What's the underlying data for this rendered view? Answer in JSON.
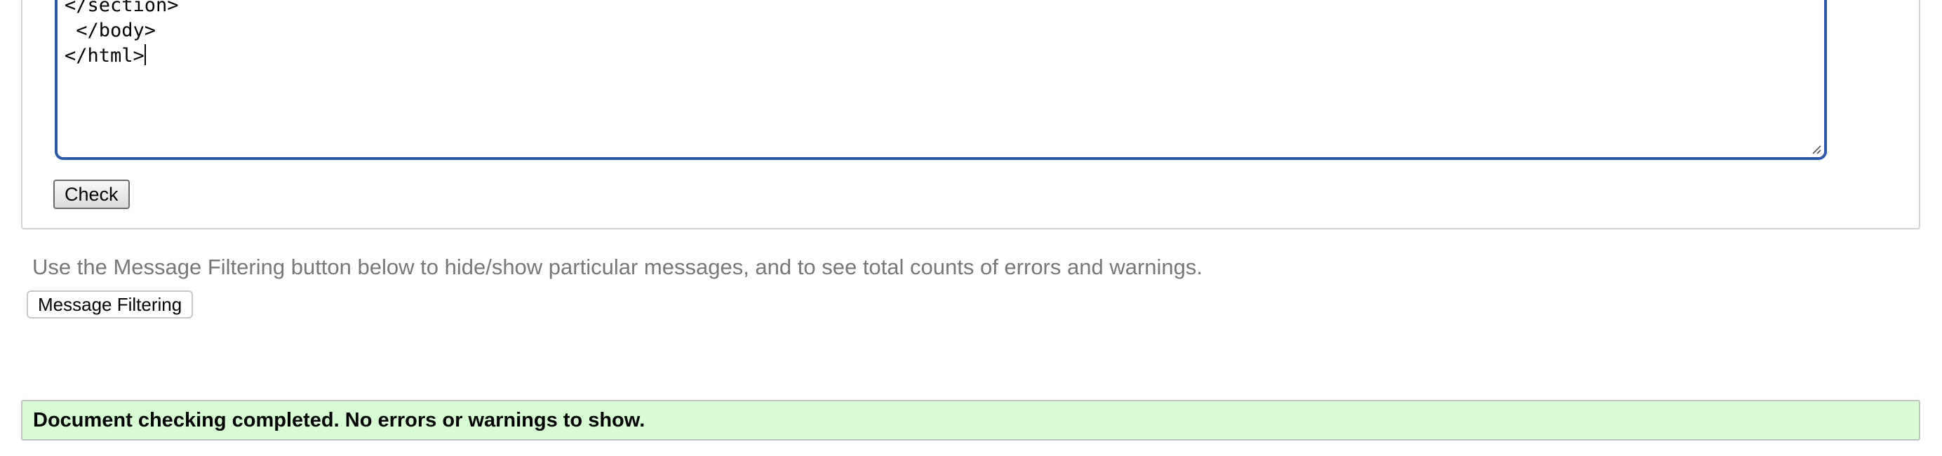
{
  "editor": {
    "lines": [
      "</section>",
      " </body>",
      "</html>"
    ]
  },
  "form": {
    "check_label": "Check"
  },
  "filtering": {
    "hint": "Use the Message Filtering button below to hide/show particular messages, and to see total counts of errors and warnings.",
    "button_label": "Message Filtering"
  },
  "result": {
    "message": "Document checking completed. No errors or warnings to show."
  },
  "colors": {
    "editor_focus_border": "#2a58b0",
    "success_background": "#d7fbd2",
    "hint_text": "#777777"
  },
  "icons": {
    "resize_grip": "resize-grip-icon"
  }
}
